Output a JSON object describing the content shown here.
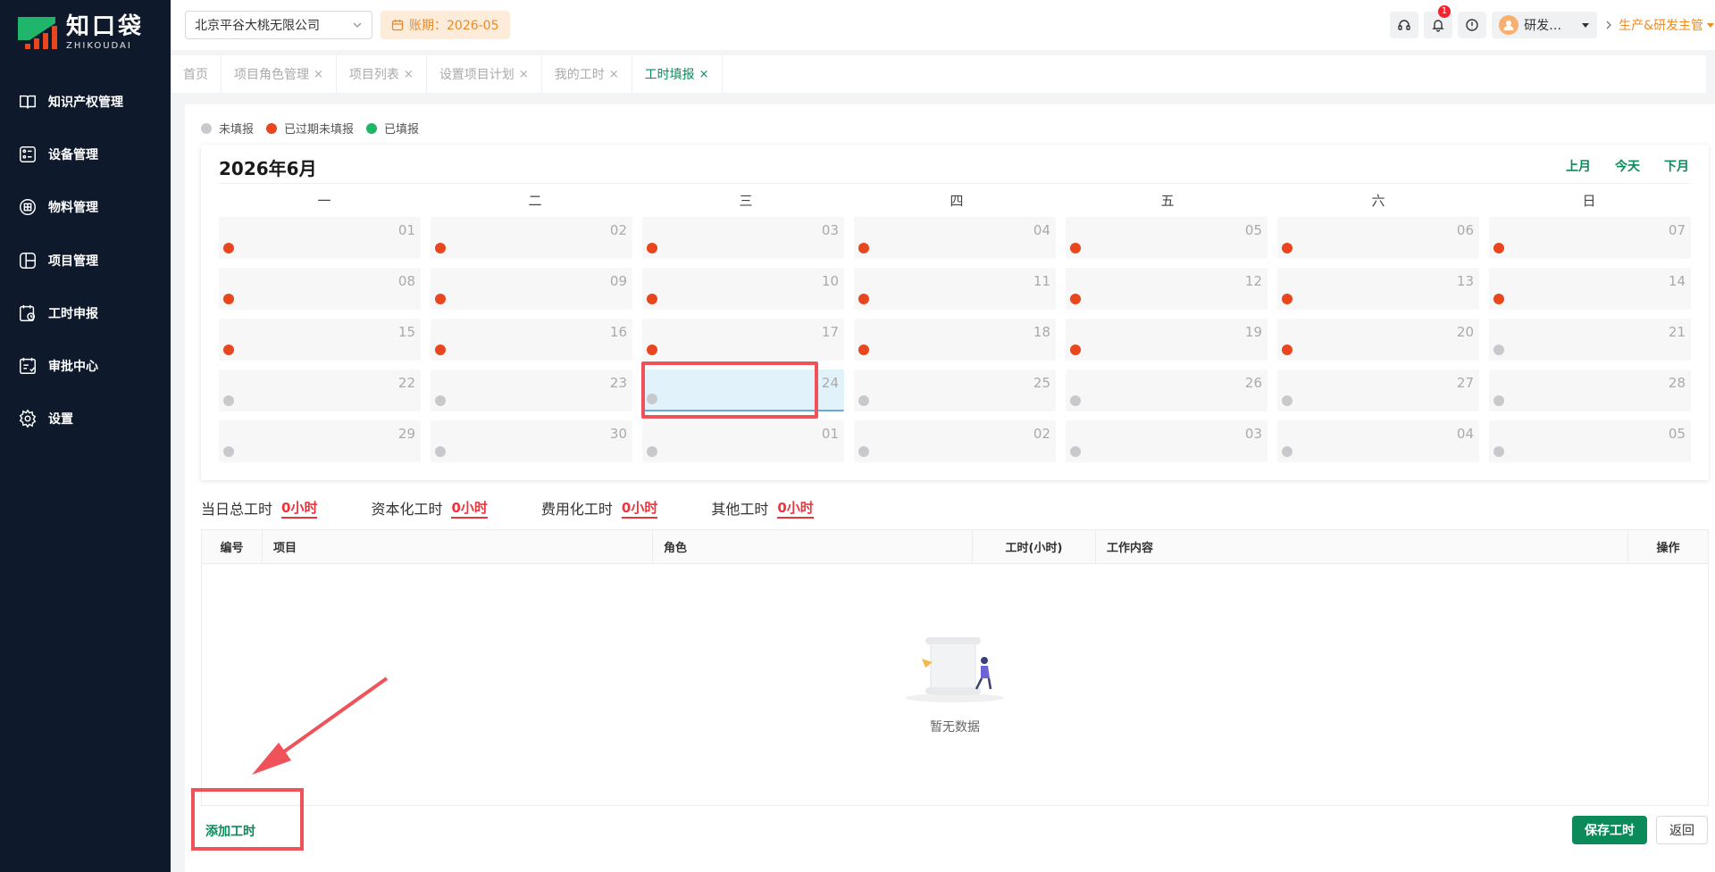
{
  "brand": {
    "name_cn": "知口袋",
    "name_en": "ZHIKOUDAI"
  },
  "sidebar": {
    "items": [
      {
        "label": "知识产权管理",
        "icon": "book-icon"
      },
      {
        "label": "设备管理",
        "icon": "device-icon"
      },
      {
        "label": "物料管理",
        "icon": "box-icon"
      },
      {
        "label": "项目管理",
        "icon": "project-icon"
      },
      {
        "label": "工时申报",
        "icon": "timesheet-icon"
      },
      {
        "label": "审批中心",
        "icon": "approval-icon"
      },
      {
        "label": "设置",
        "icon": "gear-icon"
      }
    ]
  },
  "header": {
    "company": "北京平谷大桃无限公司",
    "period": "账期：2026-05",
    "notification_count": "1",
    "user_name": "研发…",
    "role": "生产&研发主管"
  },
  "tabs": [
    {
      "label": "首页",
      "closable": false,
      "active": false
    },
    {
      "label": "项目角色管理",
      "closable": true,
      "active": false
    },
    {
      "label": "项目列表",
      "closable": true,
      "active": false
    },
    {
      "label": "设置项目计划",
      "closable": true,
      "active": false
    },
    {
      "label": "我的工时",
      "closable": true,
      "active": false
    },
    {
      "label": "工时填报",
      "closable": true,
      "active": true
    }
  ],
  "legend": [
    {
      "label": "未填报",
      "color": "#c8c9cc"
    },
    {
      "label": "已过期未填报",
      "color": "#e8461e"
    },
    {
      "label": "已填报",
      "color": "#1fb56b"
    }
  ],
  "calendar": {
    "title": "2026年6月",
    "nav": {
      "prev": "上月",
      "today": "今天",
      "next": "下月"
    },
    "weekdays": [
      "一",
      "二",
      "三",
      "四",
      "五",
      "六",
      "日"
    ],
    "selected_day": "24",
    "days": [
      {
        "d": "01",
        "s": "overdue"
      },
      {
        "d": "02",
        "s": "overdue"
      },
      {
        "d": "03",
        "s": "overdue"
      },
      {
        "d": "04",
        "s": "overdue"
      },
      {
        "d": "05",
        "s": "overdue"
      },
      {
        "d": "06",
        "s": "overdue"
      },
      {
        "d": "07",
        "s": "overdue"
      },
      {
        "d": "08",
        "s": "overdue"
      },
      {
        "d": "09",
        "s": "overdue"
      },
      {
        "d": "10",
        "s": "overdue"
      },
      {
        "d": "11",
        "s": "overdue"
      },
      {
        "d": "12",
        "s": "overdue"
      },
      {
        "d": "13",
        "s": "overdue"
      },
      {
        "d": "14",
        "s": "overdue"
      },
      {
        "d": "15",
        "s": "overdue"
      },
      {
        "d": "16",
        "s": "overdue"
      },
      {
        "d": "17",
        "s": "overdue"
      },
      {
        "d": "18",
        "s": "overdue"
      },
      {
        "d": "19",
        "s": "overdue"
      },
      {
        "d": "20",
        "s": "overdue"
      },
      {
        "d": "21",
        "s": "unfilled"
      },
      {
        "d": "22",
        "s": "unfilled"
      },
      {
        "d": "23",
        "s": "unfilled"
      },
      {
        "d": "24",
        "s": "unfilled"
      },
      {
        "d": "25",
        "s": "unfilled"
      },
      {
        "d": "26",
        "s": "unfilled"
      },
      {
        "d": "27",
        "s": "unfilled"
      },
      {
        "d": "28",
        "s": "unfilled"
      },
      {
        "d": "29",
        "s": "unfilled"
      },
      {
        "d": "30",
        "s": "unfilled"
      },
      {
        "d": "01",
        "s": "unfilled"
      },
      {
        "d": "02",
        "s": "unfilled"
      },
      {
        "d": "03",
        "s": "unfilled"
      },
      {
        "d": "04",
        "s": "unfilled"
      },
      {
        "d": "05",
        "s": "unfilled"
      }
    ]
  },
  "summary": [
    {
      "label": "当日总工时",
      "value": "0小时"
    },
    {
      "label": "资本化工时",
      "value": "0小时"
    },
    {
      "label": "费用化工时",
      "value": "0小时"
    },
    {
      "label": "其他工时",
      "value": "0小时"
    }
  ],
  "table": {
    "columns": [
      "编号",
      "项目",
      "角色",
      "工时(小时)",
      "工作内容",
      "操作"
    ],
    "empty_text": "暂无数据"
  },
  "actions": {
    "add": "添加工时",
    "save": "保存工时",
    "back": "返回"
  },
  "colors": {
    "brand": "#0b8a5a",
    "sidebar": "#0e1a2b",
    "overdue": "#e8461e",
    "unfilled": "#c8c9cc",
    "filled": "#1fb56b",
    "annotation": "#f0525a"
  }
}
